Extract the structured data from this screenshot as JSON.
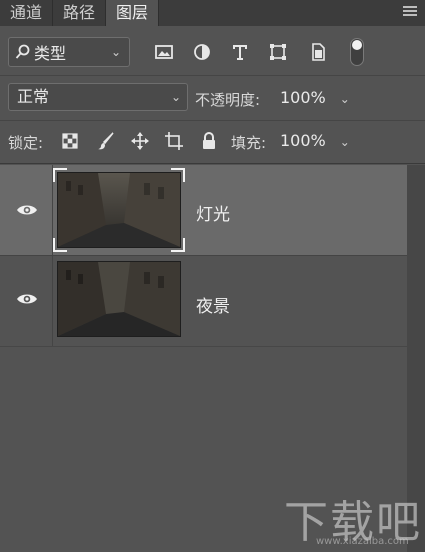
{
  "tabs": [
    {
      "label": "通道"
    },
    {
      "label": "路径"
    },
    {
      "label": "图层",
      "active": true
    }
  ],
  "filter": {
    "label": "类型"
  },
  "blend": {
    "mode": "正常",
    "opacity_label": "不透明度:",
    "opacity_value": "100%"
  },
  "lock": {
    "label": "锁定:",
    "fill_label": "填充:",
    "fill_value": "100%"
  },
  "layers": [
    {
      "name": "灯光",
      "selected": true
    },
    {
      "name": "夜景",
      "selected": false
    }
  ],
  "watermark": {
    "text": "下载吧",
    "url": "www.xiazaiba.com"
  },
  "colors": {
    "panel_bg": "#535353",
    "tabbar_bg": "#3c3c3c",
    "selected_layer": "#6a6a6a"
  }
}
